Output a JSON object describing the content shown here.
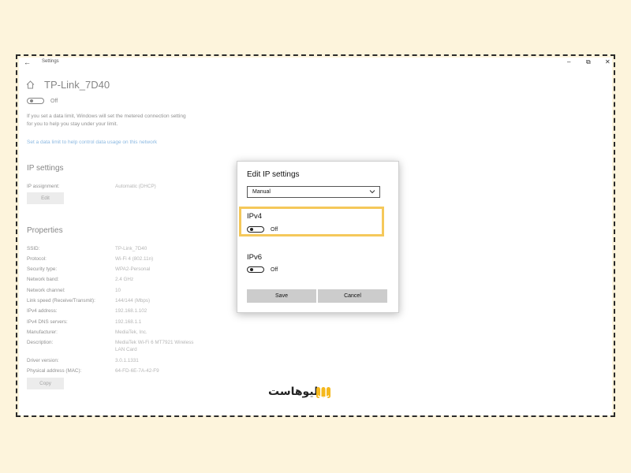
{
  "window": {
    "title": "Settings",
    "back_glyph": "←",
    "minimize_glyph": "–",
    "maximize_glyph": "⧉",
    "close_glyph": "✕"
  },
  "network": {
    "name": "TP-Link_7D40",
    "metered_toggle_label": "Off",
    "data_limit_desc_line1": "If you set a data limit, Windows will set the metered connection setting",
    "data_limit_desc_line2": "for you to help you stay under your limit.",
    "data_limit_link": "Set a data limit to help control data usage on this network"
  },
  "ip_settings": {
    "heading": "IP settings",
    "assignment_label": "IP assignment:",
    "assignment_value": "Automatic (DHCP)",
    "edit_button": "Edit"
  },
  "properties": {
    "heading": "Properties",
    "rows": [
      {
        "label": "SSID:",
        "value": "TP-Link_7D40"
      },
      {
        "label": "Protocol:",
        "value": "Wi-Fi 4 (802.11n)"
      },
      {
        "label": "Security type:",
        "value": "WPA2-Personal"
      },
      {
        "label": "Network band:",
        "value": "2.4 GHz"
      },
      {
        "label": "Network channel:",
        "value": "10"
      },
      {
        "label": "Link speed (Receive/Transmit):",
        "value": "144/144 (Mbps)"
      },
      {
        "label": "IPv4 address:",
        "value": "192.168.1.102"
      },
      {
        "label": "IPv4 DNS servers:",
        "value": "192.168.1.1"
      },
      {
        "label": "Manufacturer:",
        "value": "MediaTek, Inc."
      },
      {
        "label": "Description:",
        "value": "MediaTek Wi-Fi 6 MT7921 Wireless",
        "value2": "LAN Card"
      },
      {
        "label": "Driver version:",
        "value": "3.0.1.1331"
      },
      {
        "label": "Physical address (MAC):",
        "value": "64-FD-6E-7A-42-F9"
      }
    ],
    "copy_button": "Copy"
  },
  "dialog": {
    "title": "Edit IP settings",
    "mode_selected": "Manual",
    "ipv4_label": "IPv4",
    "ipv4_toggle_label": "Off",
    "ipv6_label": "IPv6",
    "ipv6_toggle_label": "Off",
    "save_button": "Save",
    "cancel_button": "Cancel"
  },
  "watermark": {
    "text": "لیوهاست"
  },
  "colors": {
    "page_background": "#fdf4dc",
    "highlight_border": "#f5c85a",
    "link": "#2c7fc9",
    "logo_accent": "#f5b81c"
  }
}
